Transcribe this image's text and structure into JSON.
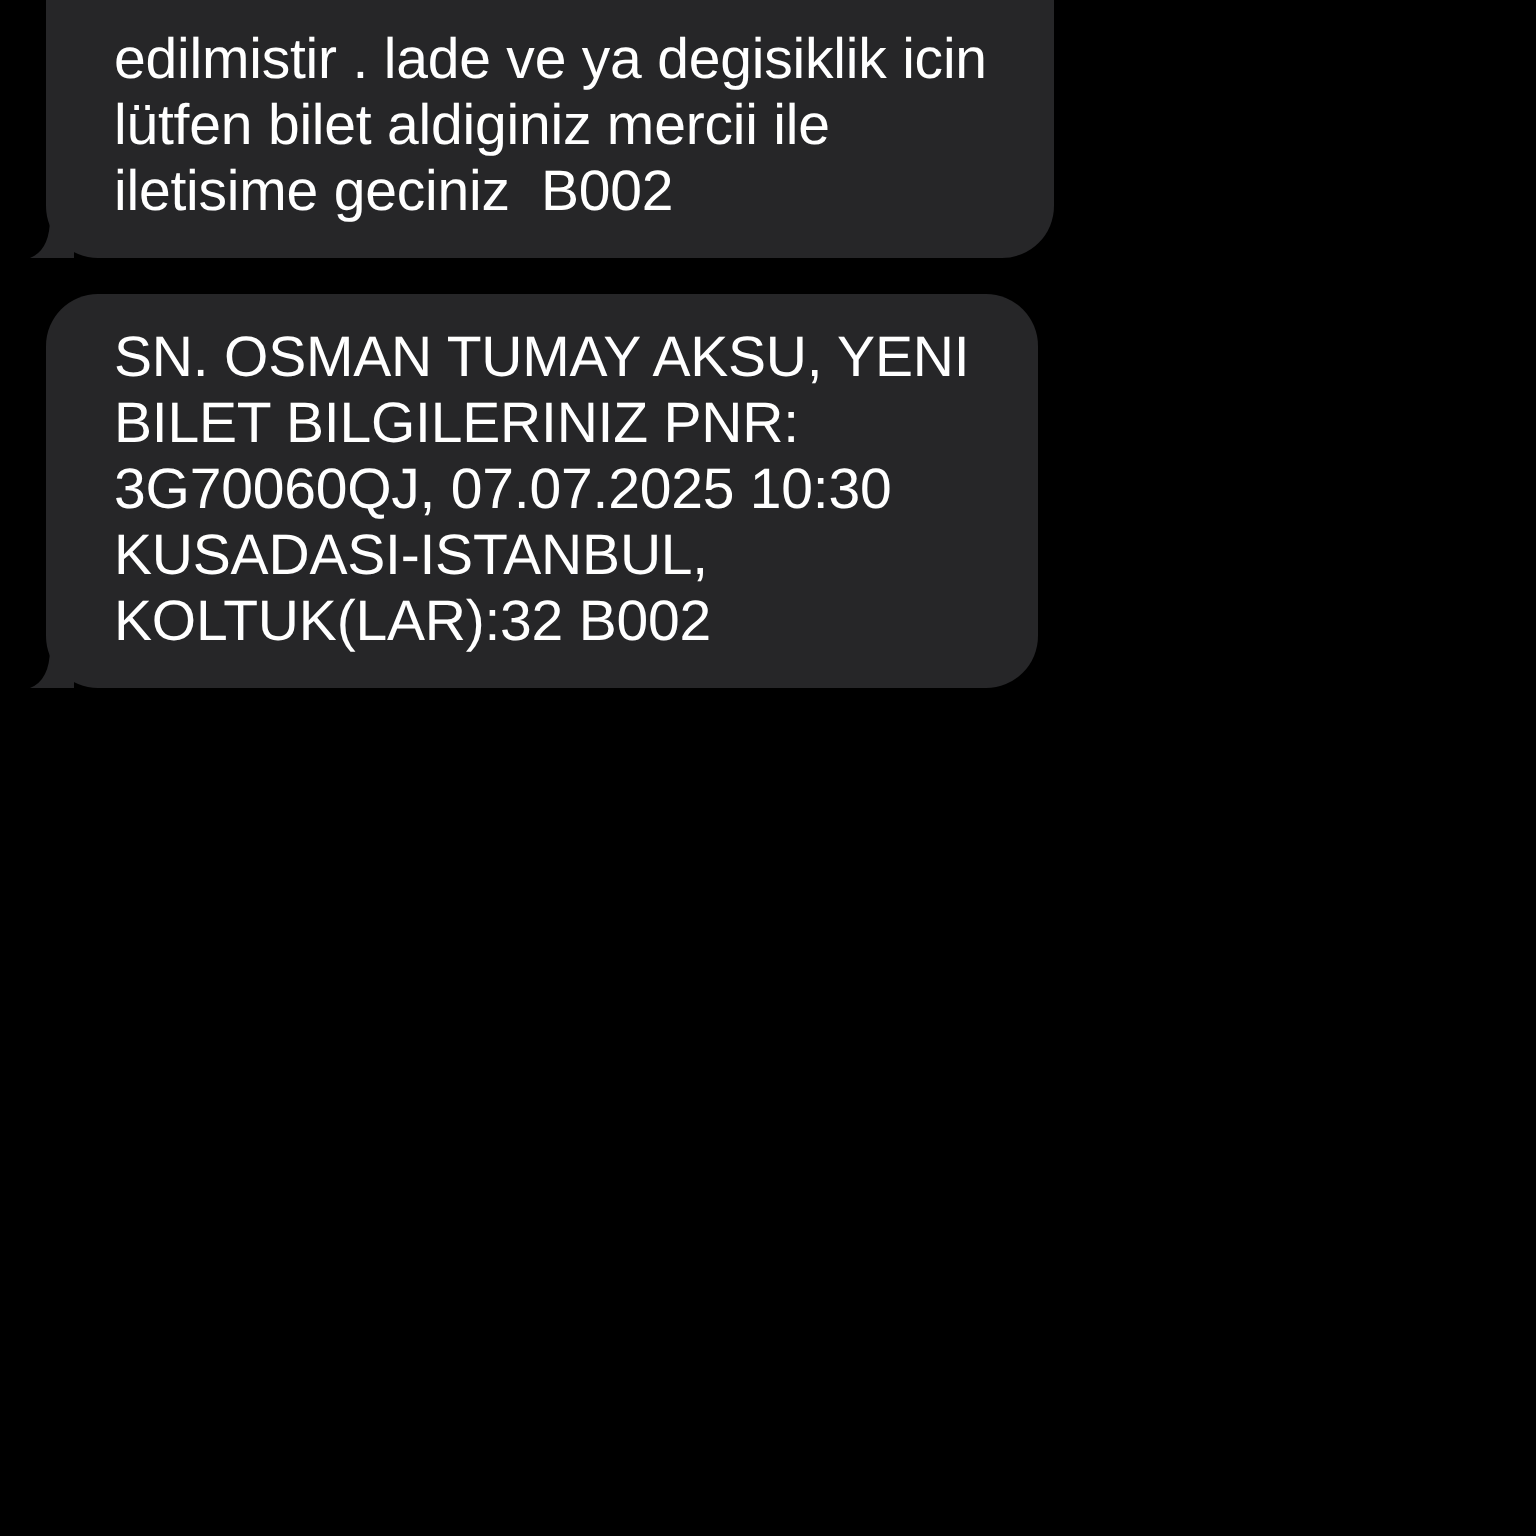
{
  "messages": [
    {
      "text": "edilmistir . lade ve ya degisiklik icin\nlütfen bilet aldiginiz mercii ile\niletisime geciniz  B002"
    },
    {
      "text": "SN. OSMAN TUMAY AKSU, YENI\nBILET BILGILERINIZ PNR:\n3G70060QJ, 07.07.2025 10:30\nKUSADASI-ISTANBUL,\nKOLTUK(LAR):32 B002"
    }
  ]
}
